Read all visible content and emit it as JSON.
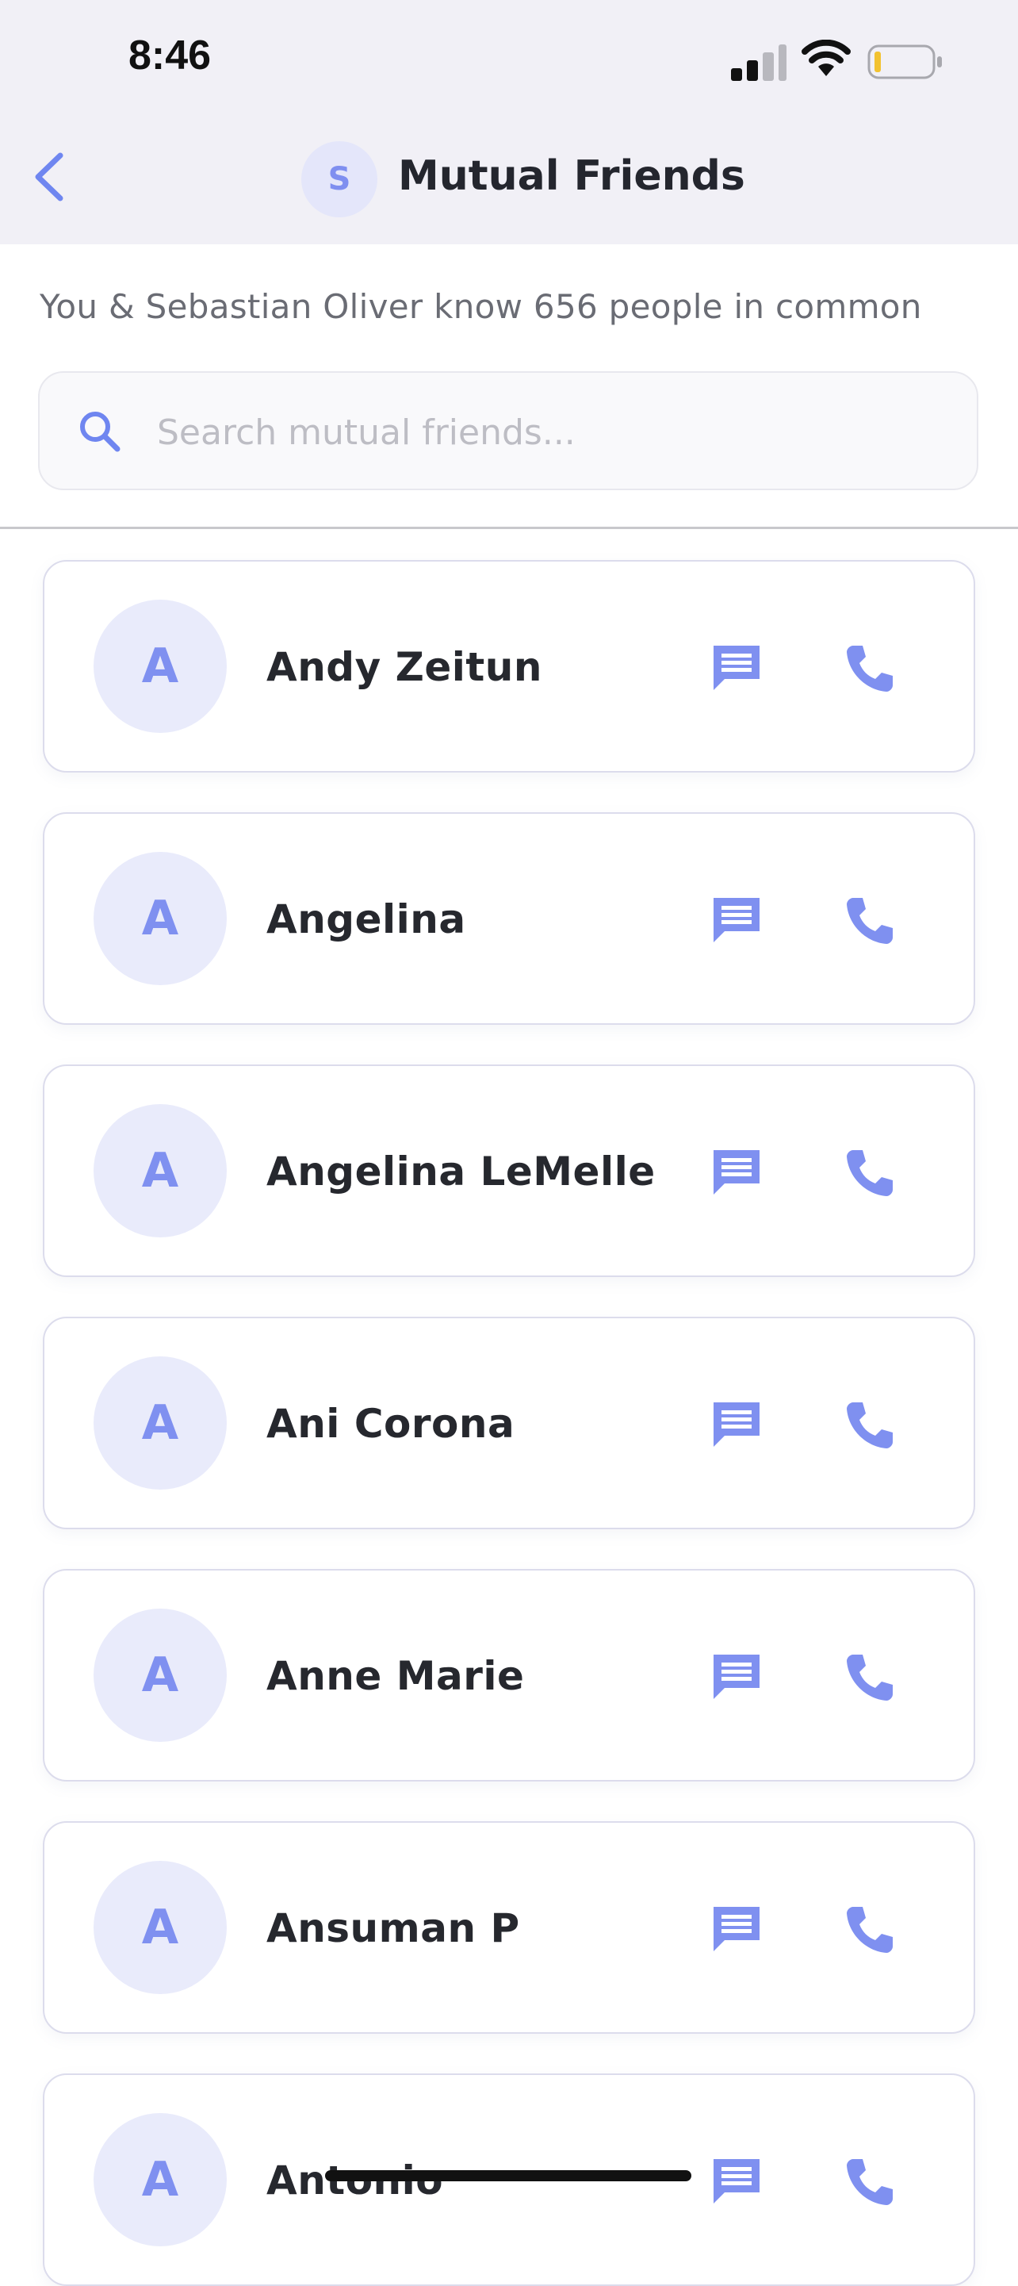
{
  "status_bar": {
    "time": "8:46"
  },
  "nav": {
    "avatar_initial": "S",
    "title": "Mutual Friends",
    "back_icon": "chevron-left-icon"
  },
  "summary": "You & Sebastian Oliver know 656 people in common",
  "search": {
    "placeholder": "Search mutual friends...",
    "value": ""
  },
  "colors": {
    "accent": "#7f90f0",
    "header_bg": "#f1f0f6",
    "avatar_bg": "#e9ebfb"
  },
  "friends": [
    {
      "initial": "A",
      "name": "Andy Zeitun"
    },
    {
      "initial": "A",
      "name": "Angelina"
    },
    {
      "initial": "A",
      "name": "Angelina LeMelle"
    },
    {
      "initial": "A",
      "name": "Ani Corona"
    },
    {
      "initial": "A",
      "name": "Anne Marie"
    },
    {
      "initial": "A",
      "name": "Ansuman P"
    },
    {
      "initial": "A",
      "name": "Antonio"
    }
  ],
  "row_icons": {
    "message": "message-icon",
    "call": "phone-icon"
  }
}
